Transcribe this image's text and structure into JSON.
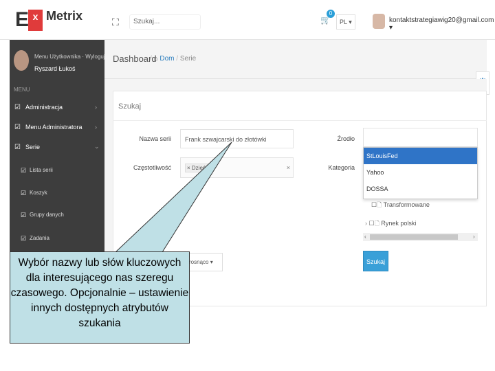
{
  "app": {
    "logo_letter": "E",
    "logo_mark": "x",
    "name": "Metrix"
  },
  "topbar": {
    "search_placeholder": "Szukaj...",
    "cart_count": "0",
    "language": "PL",
    "user_email": "kontaktstrategiawig20@gmail.com"
  },
  "sidebar": {
    "user_menu_label": "Menu Użytkownika · Wyloguj",
    "user_name": "Ryszard Łukoś",
    "section_label": "MENU",
    "items": [
      {
        "label": "Administracja"
      },
      {
        "label": "Menu Administratora"
      },
      {
        "label": "Serie"
      }
    ],
    "subitems": [
      {
        "label": "Lista serii"
      },
      {
        "label": "Koszyk"
      },
      {
        "label": "Grupy danych"
      },
      {
        "label": "Zadania"
      }
    ]
  },
  "header": {
    "title": "Dashboard",
    "breadcrumb": [
      "Dom",
      "Serie"
    ]
  },
  "panel": {
    "title": "Szukaj",
    "name_label": "Nazwa serii",
    "name_value": "Frank szwajcarski do złotówki",
    "freq_label": "Częstotliwość",
    "freq_tag": "× Dzień",
    "source_label": "Źrodło",
    "category_label": "Kategoria",
    "source_options": [
      "StLouisFed",
      "Yahoo",
      "DOSSA"
    ],
    "category_tree": [
      "Transformowane",
      "Rynek polski"
    ],
    "sort_value": "rosnąco",
    "search_button": "Szukaj"
  },
  "callout": {
    "text": "Wybór nazwy lub słów kluczowych dla interesującego nas szeregu czasowego. Opcjonalnie – ustawienie innych dostępnych atrybutów szukania"
  },
  "colors": {
    "accent": "#2b7dbd",
    "sidebar": "#3d3d3d",
    "selected": "#2f74c7",
    "logo_red": "#e03b3b",
    "callout": "#bfe0e6"
  }
}
